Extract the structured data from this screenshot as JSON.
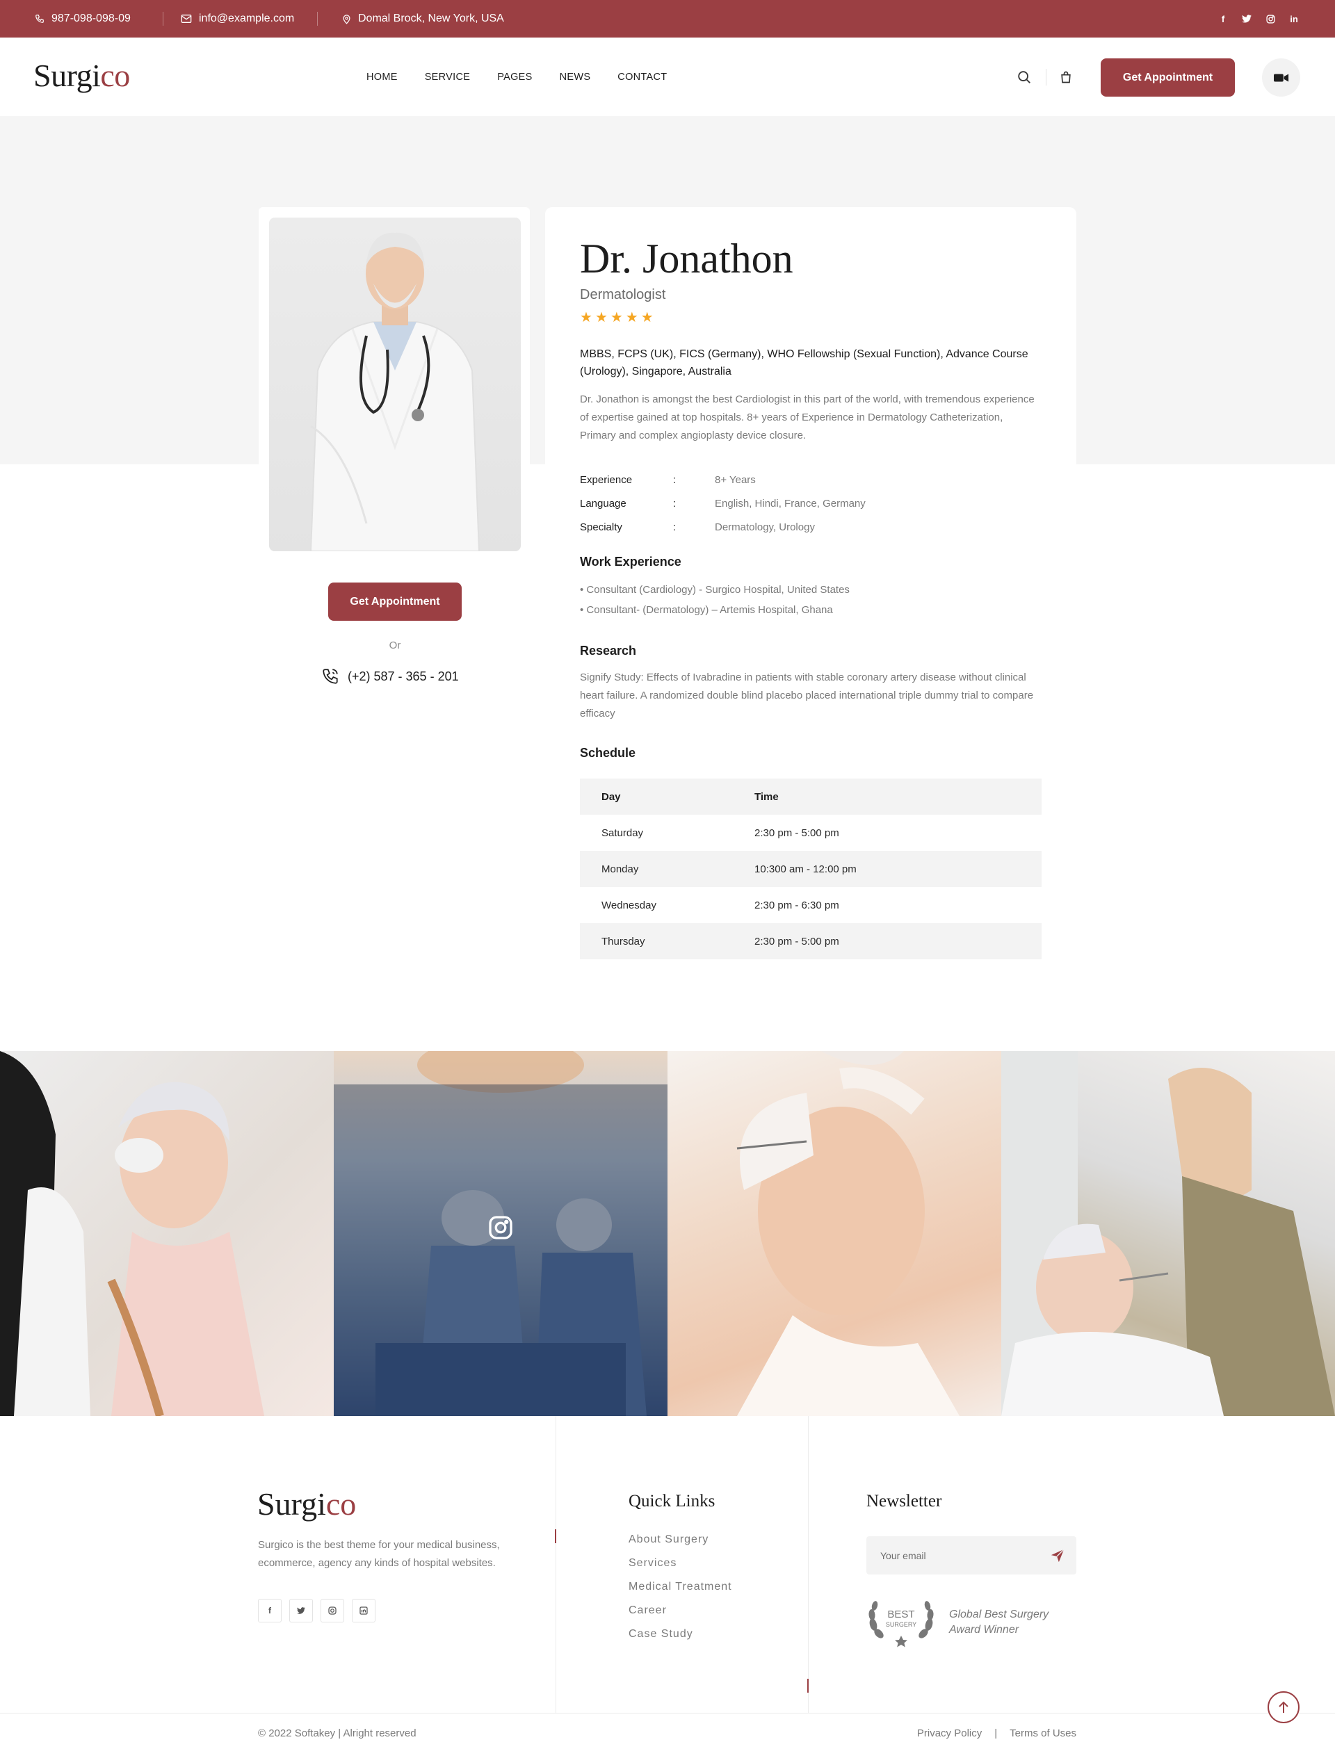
{
  "topbar": {
    "phone": "987-098-098-09",
    "email": "info@example.com",
    "address": "Domal Brock, New York, USA",
    "social": [
      "facebook-icon",
      "twitter-icon",
      "instagram-icon",
      "linkedin-icon"
    ],
    "linkedin_text": "in"
  },
  "brand": {
    "logo_main": "Surgi",
    "logo_accent": "co",
    "accent_color": "#9b3f43"
  },
  "nav": {
    "items": [
      "HOME",
      "SERVICE",
      "PAGES",
      "NEWS",
      "CONTACT"
    ]
  },
  "header": {
    "cta": "Get Appointment"
  },
  "doctor": {
    "name": "Dr. Jonathon",
    "role": "Dermatologist",
    "rating": 5,
    "qualifications": "MBBS, FCPS (UK), FICS (Germany), WHO Fellowship (Sexual Function), Advance Course (Urology), Singapore, Australia",
    "bio": "Dr. Jonathon is amongst the best Cardiologist in this part of the world, with tremendous experience of expertise gained at top hospitals. 8+ years of Experience in Dermatology Catheterization, Primary and complex angioplasty device closure.",
    "facts": [
      {
        "label": "Experience",
        "sep": ":",
        "value": "8+ Years"
      },
      {
        "label": "Language",
        "sep": ":",
        "value": "English, Hindi, France, Germany"
      },
      {
        "label": "Specialty",
        "sep": ":",
        "value": "Dermatology, Urology"
      }
    ],
    "cta": "Get Appointment",
    "or_text": "Or",
    "phone": "(+2) 587 - 365 - 201"
  },
  "work_experience": {
    "title": "Work Experience",
    "items": [
      "• Consultant (Cardiology) - Surgico Hospital, United States",
      "• Consultant- (Dermatology) – Artemis Hospital, Ghana"
    ]
  },
  "research": {
    "title": "Research",
    "text": "Signify Study: Effects of Ivabradine in patients with stable coronary artery disease without clinical heart failure. A randomized double blind placebo placed international triple dummy trial to compare efficacy"
  },
  "schedule": {
    "title": "Schedule",
    "headers": {
      "day": "Day",
      "time": "Time"
    },
    "rows": [
      {
        "day": "Saturday",
        "time": "2:30 pm - 5:00 pm"
      },
      {
        "day": "Monday",
        "time": "10:300 am - 12:00 pm"
      },
      {
        "day": "Wednesday",
        "time": "2:30 pm - 6:30 pm"
      },
      {
        "day": "Thursday",
        "time": "2:30 pm - 5:00 pm"
      }
    ]
  },
  "footer": {
    "logo_main": "Surgi",
    "logo_accent": "co",
    "description": "Surgico is the best theme for your medical business, ecommerce, agency any kinds of hospital websites.",
    "quick_links_title": "Quick Links",
    "quick_links": [
      "About Surgery",
      "Services",
      "Medical Treatment",
      "Career",
      "Case Study"
    ],
    "newsletter_title": "Newsletter",
    "email_placeholder": "Your email",
    "award_badge": {
      "line1": "BEST",
      "line2": "SURGERY"
    },
    "award_text_1": "Global Best Surgery",
    "award_text_2": "Award Winner",
    "copyright": "© 2022 Softakey | Alright reserved",
    "legal": [
      "Privacy Policy",
      "|",
      "Terms of Uses"
    ]
  }
}
